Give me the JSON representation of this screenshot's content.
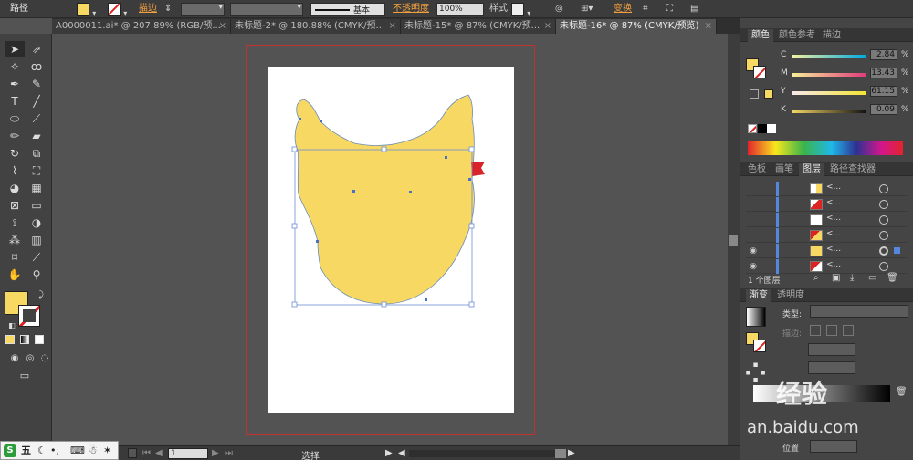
{
  "control_bar": {
    "object_type": "路径",
    "stroke_label": "描边",
    "stroke_value": "",
    "brush_style": "基本",
    "opacity_label": "不透明度",
    "opacity_value": "100%",
    "style_label": "样式",
    "transform_label": "变换",
    "fill_color": "#f7d862"
  },
  "tabs": [
    {
      "label": "A0000011.ai* @ 207.89% (RGB/预...",
      "active": false
    },
    {
      "label": "未标题-2* @ 180.88% (CMYK/预...",
      "active": false
    },
    {
      "label": "未标题-15* @ 87% (CMYK/预...",
      "active": false
    },
    {
      "label": "未标题-16* @ 87% (CMYK/预览)",
      "active": true
    }
  ],
  "tools": [
    "selection",
    "direct-selection",
    "magic-wand",
    "lasso",
    "pen",
    "curvature",
    "type",
    "line",
    "ellipse",
    "paintbrush",
    "pencil",
    "eraser",
    "rotate",
    "scale",
    "warp",
    "free-transform",
    "shape-builder",
    "perspective",
    "mesh",
    "gradient",
    "eyedropper",
    "blend",
    "symbol-sprayer",
    "column-graph",
    "artboard",
    "slice",
    "hand",
    "zoom"
  ],
  "toolbar_fill_color": "#f7d862",
  "color_panel": {
    "tabs": [
      "颜色",
      "颜色参考",
      "描边"
    ],
    "sliders": [
      {
        "label": "C",
        "value": "2.84",
        "unit": "%"
      },
      {
        "label": "M",
        "value": "13.43",
        "unit": "%"
      },
      {
        "label": "Y",
        "value": "61.15",
        "unit": "%"
      },
      {
        "label": "K",
        "value": "0.09",
        "unit": "%"
      }
    ]
  },
  "layers_panel": {
    "tabs": [
      "色板",
      "画笔",
      "图层",
      "路径查找器"
    ],
    "rows": [
      {
        "name": "<...",
        "thumb": "yellow-red"
      },
      {
        "name": "<...",
        "thumb": "red"
      },
      {
        "name": "<...",
        "thumb": "white"
      },
      {
        "name": "<...",
        "thumb": "red-yellow"
      },
      {
        "name": "<...",
        "thumb": "yellow"
      },
      {
        "name": "<...",
        "thumb": "red"
      }
    ],
    "footer": "1 个图层"
  },
  "gradient_panel": {
    "tabs": [
      "渐变",
      "透明度"
    ],
    "type_label": "类型:",
    "stroke_label": "描边:",
    "position_label": "位置"
  },
  "status": {
    "zoom": "87%",
    "page": "1",
    "mode": "选择"
  },
  "ime": {
    "label": "五"
  },
  "watermark": {
    "brand": "经验",
    "url": "jingyan.baidu.com",
    "visible_url": "an.baidu.com"
  }
}
